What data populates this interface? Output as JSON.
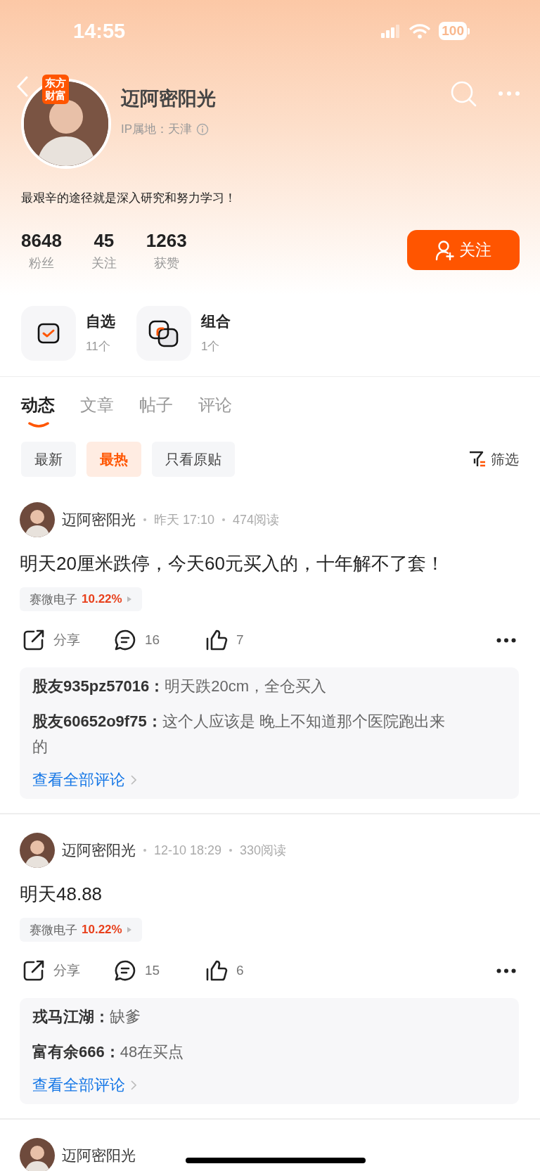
{
  "status_bar": {
    "time": "14:55",
    "battery": "100"
  },
  "profile": {
    "badge": "东方财富",
    "name": "迈阿密阳光",
    "ip_label": "IP属地：天津",
    "bio": "最艰辛的途径就是深入研究和努力学习！",
    "stats": [
      {
        "value": "8648",
        "label": "粉丝"
      },
      {
        "value": "45",
        "label": "关注"
      },
      {
        "value": "1263",
        "label": "获赞"
      }
    ],
    "follow_button": "关注"
  },
  "shortcuts": [
    {
      "kind": "watchlist",
      "title": "自选",
      "count": "11个"
    },
    {
      "kind": "portfolio",
      "title": "组合",
      "count": "1个"
    }
  ],
  "tabs": [
    {
      "label": "动态",
      "selected": true
    },
    {
      "label": "文章",
      "selected": false
    },
    {
      "label": "帖子",
      "selected": false
    },
    {
      "label": "评论",
      "selected": false
    }
  ],
  "filters": [
    {
      "label": "最新",
      "selected": false
    },
    {
      "label": "最热",
      "selected": true
    },
    {
      "label": "只看原贴",
      "selected": false
    }
  ],
  "filter_button": "筛选",
  "posts": [
    {
      "author": "迈阿密阳光",
      "time": "昨天 17:10",
      "reads": "474阅读",
      "text": "明天20厘米跌停，今天60元买入的，十年解不了套！",
      "stock": {
        "name": "赛微电子",
        "change": "10.22%"
      },
      "share": "分享",
      "comments": "16",
      "likes": "7",
      "replies": [
        {
          "user": "股友935pz57016：",
          "text": "明天跌20cm，全仓买入"
        },
        {
          "user": "股友60652o9f75：",
          "text": "这个人应该是 晚上不知道那个医院跑出来的"
        }
      ],
      "more": "查看全部评论"
    },
    {
      "author": "迈阿密阳光",
      "time": "12-10 18:29",
      "reads": "330阅读",
      "text": "明天48.88",
      "stock": {
        "name": "赛微电子",
        "change": "10.22%"
      },
      "share": "分享",
      "comments": "15",
      "likes": "6",
      "replies": [
        {
          "user": "戎马江湖：",
          "text": "缺爹"
        },
        {
          "user": "富有余666：",
          "text": "48在买点"
        }
      ],
      "more": "查看全部评论"
    },
    {
      "author": "迈阿密阳光"
    }
  ]
}
